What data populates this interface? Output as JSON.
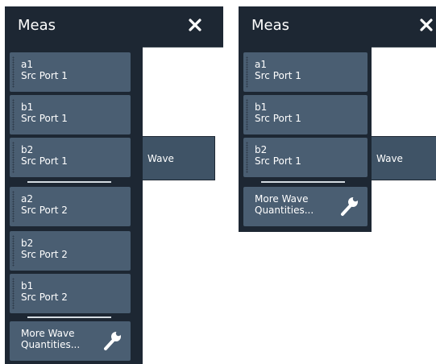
{
  "left_panel": {
    "title": "Meas",
    "items": [
      {
        "line1": "a1",
        "line2": "Src Port 1"
      },
      {
        "line1": "b1",
        "line2": "Src Port 1"
      },
      {
        "line1": "b2",
        "line2": "Src Port 1"
      },
      {
        "line1": "a2",
        "line2": "Src Port 2"
      },
      {
        "line1": "b2",
        "line2": "Src Port 2"
      },
      {
        "line1": "b1",
        "line2": "Src Port 2"
      }
    ],
    "more": {
      "line1": "More Wave",
      "line2": "Quantities..."
    },
    "submenu_label": "Wave"
  },
  "right_panel": {
    "title": "Meas",
    "items": [
      {
        "line1": "a1",
        "line2": "Src Port 1"
      },
      {
        "line1": "b1",
        "line2": "Src Port 1"
      },
      {
        "line1": "b2",
        "line2": "Src Port 1"
      }
    ],
    "more": {
      "line1": "More Wave",
      "line2": "Quantities..."
    },
    "submenu_label": "Wave"
  },
  "icons": {
    "close": "close-icon",
    "wrench": "wrench-icon"
  },
  "colors": {
    "panel_bg": "#1d2733",
    "button_bg": "#4a5e72",
    "text": "#ffffff"
  }
}
